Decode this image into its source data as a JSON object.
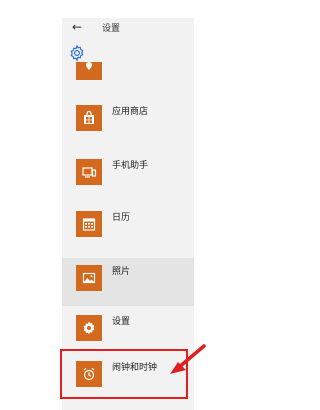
{
  "header": {
    "back_icon": "←",
    "title": "设置"
  },
  "apps": [
    {
      "label": "应用商店",
      "icon": "store-icon"
    },
    {
      "label": "手机助手",
      "icon": "phone-companion-icon"
    },
    {
      "label": "日历",
      "icon": "calendar-icon"
    },
    {
      "label": "照片",
      "icon": "photos-icon"
    },
    {
      "label": "设置",
      "icon": "settings-gear-icon"
    },
    {
      "label": "闹钟和时钟",
      "icon": "alarm-clock-icon"
    }
  ],
  "colors": {
    "tile": "#d2691e",
    "highlight": "#e02020",
    "selected_row": "#e4e4e4",
    "panel": "#f2f2f2"
  }
}
